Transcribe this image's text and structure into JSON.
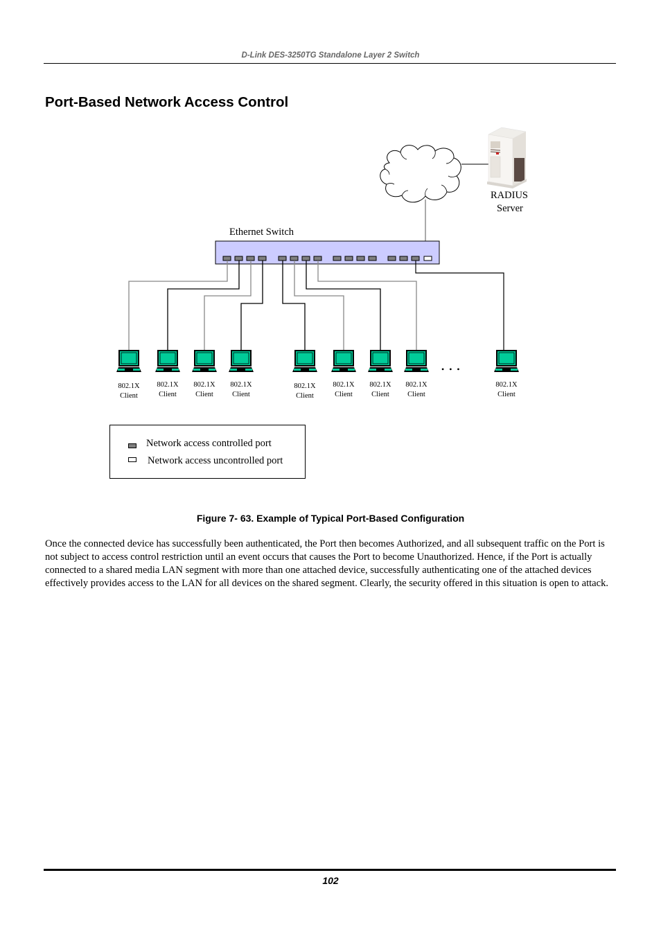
{
  "header": {
    "running_title": "D-Link DES-3250TG Standalone Layer 2 Switch"
  },
  "section": {
    "title": "Port-Based Network Access Control"
  },
  "figure": {
    "switch_label": "Ethernet Switch",
    "server_label_line1": "RADIUS",
    "server_label_line2": "Server",
    "ellipsis": "• • •",
    "clients": [
      {
        "line1": "802.1X",
        "line2": "Client"
      },
      {
        "line1": "802.1X",
        "line2": "Client"
      },
      {
        "line1": "802.1X",
        "line2": "Client"
      },
      {
        "line1": "802.1X",
        "line2": "Client"
      },
      {
        "line1": "802.1X",
        "line2": "Client"
      },
      {
        "line1": "802.1X",
        "line2": "Client"
      },
      {
        "line1": "802.1X",
        "line2": "Client"
      },
      {
        "line1": "802.1X",
        "line2": "Client"
      },
      {
        "line1": "802.1X",
        "line2": "Client"
      }
    ],
    "legend": {
      "controlled": "Network access controlled port",
      "uncontrolled": "Network access uncontrolled port"
    },
    "colors": {
      "switch_fill": "#ccccff",
      "controlled_port": "#808080",
      "uncontrolled_port": "#ffffff",
      "laptop_screen": "#00cc99"
    },
    "caption": "Figure 7- 63. Example of Typical Port-Based Configuration"
  },
  "body": {
    "paragraph": "Once the connected device has successfully been authenticated, the Port then becomes Authorized, and all subsequent traffic on the Port is not subject to access control restriction until an event occurs that causes the Port to become Unauthorized. Hence, if the Port is actually connected to a shared media LAN segment with more than one attached device, successfully authenticating one of the attached devices effectively provides access to the LAN for all devices on the shared segment. Clearly, the security offered in this situation is open to attack."
  },
  "footer": {
    "page_number": "102"
  }
}
